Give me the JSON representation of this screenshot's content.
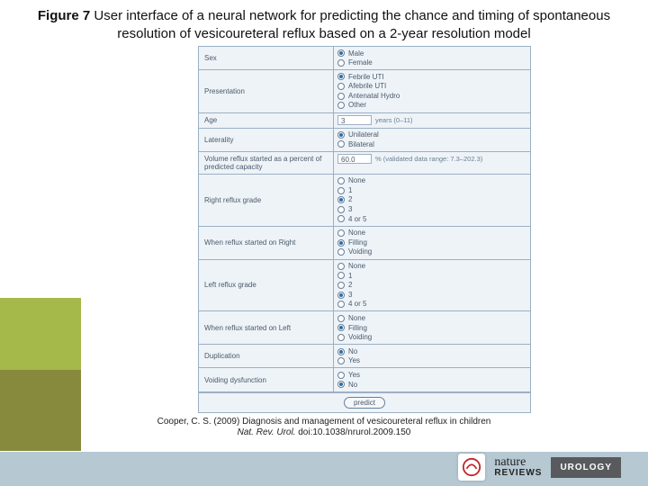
{
  "title_prefix": "Figure 7",
  "title_rest": " User interface of a neural network for predicting the chance and timing of spontaneous resolution of vesicoureteral reflux based on a 2‑year resolution model",
  "form": {
    "rows": [
      {
        "label": "Sex",
        "opts": [
          {
            "t": "Male",
            "sel": true
          },
          {
            "t": "Female",
            "sel": false
          }
        ]
      },
      {
        "label": "Presentation",
        "opts": [
          {
            "t": "Febrile UTI",
            "sel": true
          },
          {
            "t": "Afebrile UTI",
            "sel": false
          },
          {
            "t": "Antenatal Hydro",
            "sel": false
          },
          {
            "t": "Other",
            "sel": false
          }
        ]
      },
      {
        "label": "Age",
        "input": {
          "value": "3",
          "suffix": "years (0–11)"
        }
      },
      {
        "label": "Laterality",
        "opts": [
          {
            "t": "Unilateral",
            "sel": true
          },
          {
            "t": "Bilateral",
            "sel": false
          }
        ]
      },
      {
        "label": "Volume reflux started as a percent of predicted capacity",
        "input": {
          "value": "60.0",
          "suffix": "% (validated data range: 7.3–202.3)"
        }
      },
      {
        "label": "Right reflux grade",
        "opts": [
          {
            "t": "None",
            "sel": false
          },
          {
            "t": "1",
            "sel": false
          },
          {
            "t": "2",
            "sel": true
          },
          {
            "t": "3",
            "sel": false
          },
          {
            "t": "4 or 5",
            "sel": false
          }
        ]
      },
      {
        "label": "When reflux started on Right",
        "opts": [
          {
            "t": "None",
            "sel": false
          },
          {
            "t": "Filling",
            "sel": true
          },
          {
            "t": "Voiding",
            "sel": false
          }
        ]
      },
      {
        "label": "Left reflux grade",
        "opts": [
          {
            "t": "None",
            "sel": false
          },
          {
            "t": "1",
            "sel": false
          },
          {
            "t": "2",
            "sel": false
          },
          {
            "t": "3",
            "sel": true
          },
          {
            "t": "4 or 5",
            "sel": false
          }
        ]
      },
      {
        "label": "When reflux started on Left",
        "opts": [
          {
            "t": "None",
            "sel": false
          },
          {
            "t": "Filling",
            "sel": true
          },
          {
            "t": "Voiding",
            "sel": false
          }
        ]
      },
      {
        "label": "Duplication",
        "opts": [
          {
            "t": "No",
            "sel": true
          },
          {
            "t": "Yes",
            "sel": false
          }
        ]
      },
      {
        "label": "Voiding dysfunction",
        "opts": [
          {
            "t": "Yes",
            "sel": false
          },
          {
            "t": "No",
            "sel": true
          }
        ]
      }
    ],
    "predict_label": "predict"
  },
  "citation": {
    "line1": "Cooper, C. S. (2009) Diagnosis and management of vesicoureteral reflux in children",
    "journal": "Nat. Rev. Urol.",
    "doi": " doi:10.1038/nrurol.2009.150"
  },
  "logo": {
    "nature": "nature",
    "reviews": "REVIEWS",
    "urology": "UROLOGY"
  }
}
